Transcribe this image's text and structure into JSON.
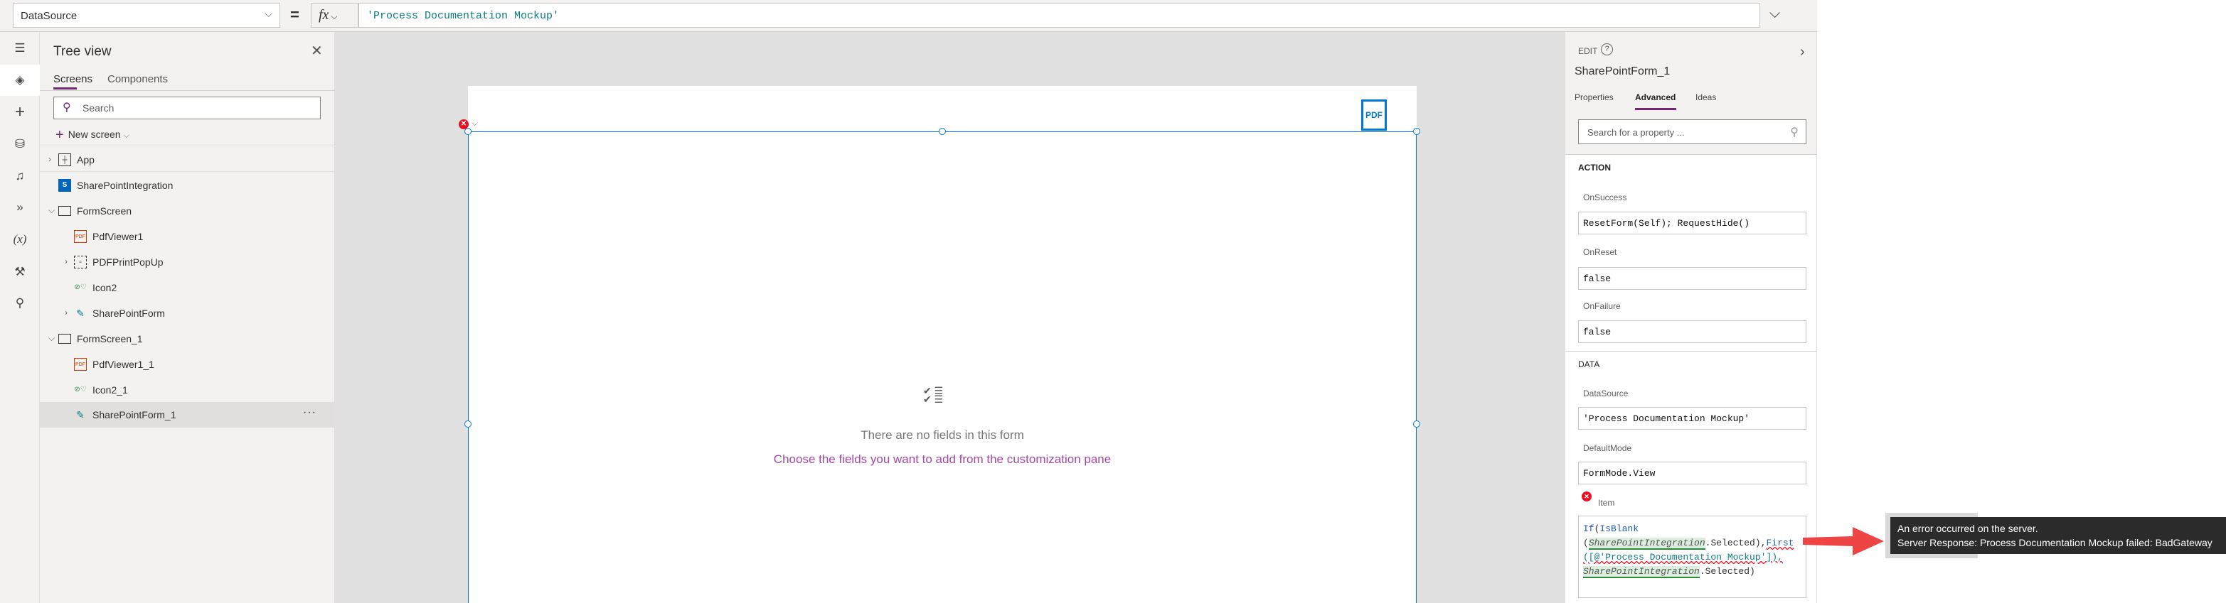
{
  "formula_bar": {
    "property": "DataSource",
    "equals": "=",
    "fx": "fx",
    "formula": "'Process Documentation Mockup'"
  },
  "rail": {
    "icons": [
      "hamburger-icon",
      "layers-icon",
      "plus-icon",
      "database-icon",
      "media-icon",
      "power-automate-icon",
      "variables-icon",
      "tools-icon",
      "search-icon"
    ],
    "variables_label": "(x)"
  },
  "tree": {
    "title": "Tree view",
    "tabs": [
      "Screens",
      "Components"
    ],
    "search_placeholder": "Search",
    "new_screen": "New screen",
    "items": [
      {
        "label": "App"
      },
      {
        "label": "SharePointIntegration"
      },
      {
        "label": "FormScreen"
      },
      {
        "label": "PdfViewer1"
      },
      {
        "label": "PDFPrintPopUp"
      },
      {
        "label": "Icon2"
      },
      {
        "label": "SharePointForm"
      },
      {
        "label": "FormScreen_1"
      },
      {
        "label": "PdfViewer1_1"
      },
      {
        "label": "Icon2_1"
      },
      {
        "label": "SharePointForm_1"
      }
    ],
    "more": "···"
  },
  "canvas": {
    "pdf_label": "PDF",
    "empty_title": "There are no fields in this form",
    "empty_hint": "Choose the fields you want to add from the customization pane"
  },
  "panel": {
    "edit": "EDIT",
    "title": "SharePointForm_1",
    "tabs": [
      "Properties",
      "Advanced",
      "Ideas"
    ],
    "search_placeholder": "Search for a property ...",
    "action": {
      "heading": "ACTION",
      "on_success_label": "OnSuccess",
      "on_success": "ResetForm(Self); RequestHide()",
      "on_reset_label": "OnReset",
      "on_reset": "false",
      "on_failure_label": "OnFailure",
      "on_failure": "false"
    },
    "data": {
      "heading": "DATA",
      "datasource_label": "DataSource",
      "datasource": "'Process Documentation Mockup'",
      "defaultmode_label": "DefaultMode",
      "defaultmode": "FormMode.View",
      "item_label": "Item",
      "item_parts": [
        "If",
        "(",
        "IsBlank",
        "(",
        "SharePointIntegration",
        ".Selected),",
        "First",
        "([@'Process Documentation Mockup']),",
        "SharePointIntegration",
        ".Selected)"
      ]
    }
  },
  "tooltip": {
    "line1": "An error occurred on the server.",
    "line2": "Server Response: Process Documentation Mockup failed: BadGateway"
  },
  "colors": {
    "accent": "#742774",
    "error": "#e81123",
    "selection": "#0078d4",
    "arrow": "#ef4444"
  }
}
